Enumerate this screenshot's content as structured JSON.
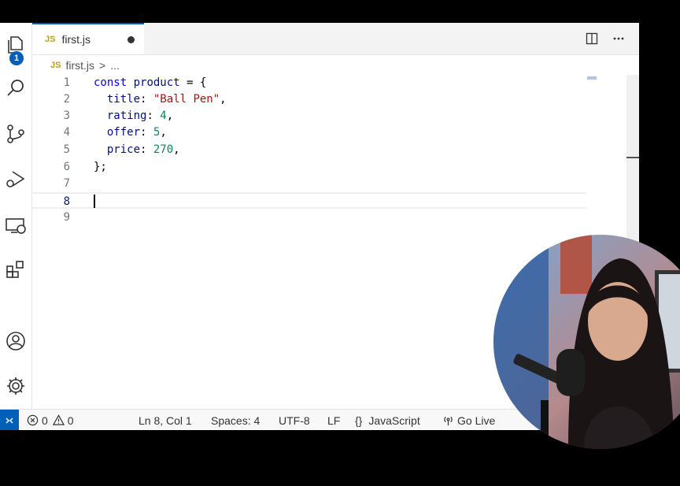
{
  "activity_bar": {
    "explorer_badge": "1",
    "icons": [
      "files-icon",
      "search-icon",
      "source-control-icon",
      "run-debug-icon",
      "remote-explorer-icon",
      "extensions-icon",
      "account-icon",
      "settings-gear-icon"
    ]
  },
  "tab": {
    "badge": "JS",
    "title": "first.js"
  },
  "breadcrumb": {
    "badge": "JS",
    "file": "first.js",
    "sep": ">",
    "more": "..."
  },
  "editor": {
    "lines": [
      {
        "n": "1"
      },
      {
        "n": "2"
      },
      {
        "n": "3"
      },
      {
        "n": "4"
      },
      {
        "n": "5"
      },
      {
        "n": "6"
      },
      {
        "n": "7"
      },
      {
        "n": "8"
      },
      {
        "n": "9"
      }
    ],
    "tokens": {
      "l1": {
        "kw": "const",
        "name": "product",
        "rest": " = {"
      },
      "l2": {
        "prop": "title",
        "colon": ": ",
        "val": "\"Ball Pen\"",
        "end": ","
      },
      "l3": {
        "prop": "rating",
        "colon": ": ",
        "val": "4",
        "end": ","
      },
      "l4": {
        "prop": "offer",
        "colon": ": ",
        "val": "5",
        "end": ","
      },
      "l5": {
        "prop": "price",
        "colon": ": ",
        "val": "270",
        "end": ","
      },
      "l6": {
        "text": "};"
      }
    },
    "cursor_line": 8
  },
  "statusbar": {
    "errors": "0",
    "warnings": "0",
    "position": "Ln 8, Col 1",
    "spaces": "Spaces: 4",
    "encoding": "UTF-8",
    "eol": "LF",
    "language_icon": "{}",
    "language": "JavaScript",
    "golive": "Go Live"
  },
  "colors": {
    "accent": "#005fb8",
    "keyword": "#0000ff",
    "string": "#a31515",
    "number": "#098658",
    "variable": "#001080"
  }
}
